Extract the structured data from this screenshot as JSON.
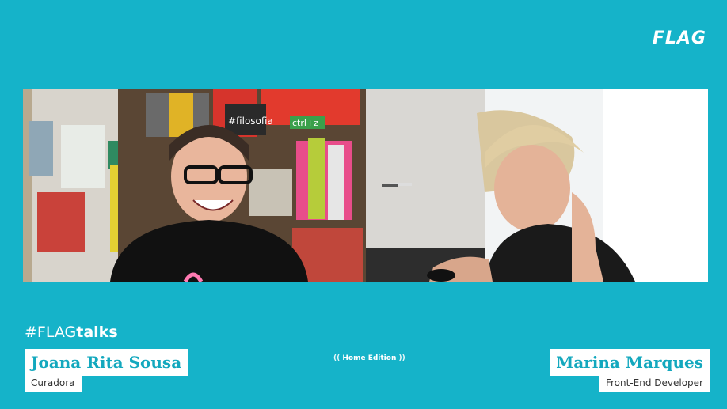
{
  "brand": {
    "logo_text": "FLAG"
  },
  "show": {
    "hashtag_prefix": "#FLAG",
    "hashtag_suffix": "talks",
    "edition_label": "Home Edition"
  },
  "participants": [
    {
      "name": "Joana Rita Sousa",
      "role": "Curadora"
    },
    {
      "name": "Marina Marques",
      "role": "Front-End Developer"
    }
  ],
  "colors": {
    "background": "#15b3c9",
    "name_text": "#13a8be"
  },
  "videos": {
    "left": {
      "bookshelf_label": "#filosofia",
      "sign_label": "ctrl+z"
    }
  }
}
